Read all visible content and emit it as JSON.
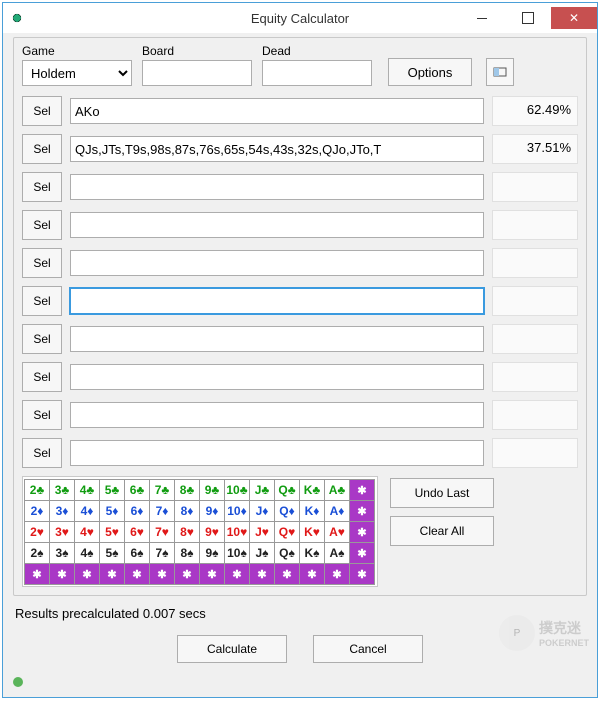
{
  "title": "Equity Calculator",
  "labels": {
    "game": "Game",
    "board": "Board",
    "dead": "Dead"
  },
  "game_options": [
    "Holdem"
  ],
  "game_selected": "Holdem",
  "board_value": "",
  "dead_value": "",
  "options_btn": "Options",
  "sel_btn": "Sel",
  "rows": [
    {
      "range": "AKo",
      "equity": "62.49%",
      "focus": false
    },
    {
      "range": "QJs,JTs,T9s,98s,87s,76s,65s,54s,43s,32s,QJo,JTo,T",
      "equity": "37.51%",
      "focus": false
    },
    {
      "range": "",
      "equity": "",
      "focus": false
    },
    {
      "range": "",
      "equity": "",
      "focus": false
    },
    {
      "range": "",
      "equity": "",
      "focus": false
    },
    {
      "range": "",
      "equity": "",
      "focus": true
    },
    {
      "range": "",
      "equity": "",
      "focus": false
    },
    {
      "range": "",
      "equity": "",
      "focus": false
    },
    {
      "range": "",
      "equity": "",
      "focus": false
    },
    {
      "range": "",
      "equity": "",
      "focus": false
    }
  ],
  "ranks": [
    "2",
    "3",
    "4",
    "5",
    "6",
    "7",
    "8",
    "9",
    "10",
    "J",
    "Q",
    "K",
    "A"
  ],
  "suits": [
    {
      "sym": "♣",
      "cls": "s-c"
    },
    {
      "sym": "♦",
      "cls": "s-d"
    },
    {
      "sym": "♥",
      "cls": "s-h"
    },
    {
      "sym": "♠",
      "cls": "s-s"
    }
  ],
  "extra_star": "✱",
  "buttons": {
    "undo": "Undo Last",
    "clear": "Clear All",
    "calc": "Calculate",
    "cancel": "Cancel"
  },
  "status": "Results precalculated 0.007 secs",
  "watermark": {
    "badge": "P",
    "line1": "撲克迷",
    "line2": "POKERNET"
  }
}
